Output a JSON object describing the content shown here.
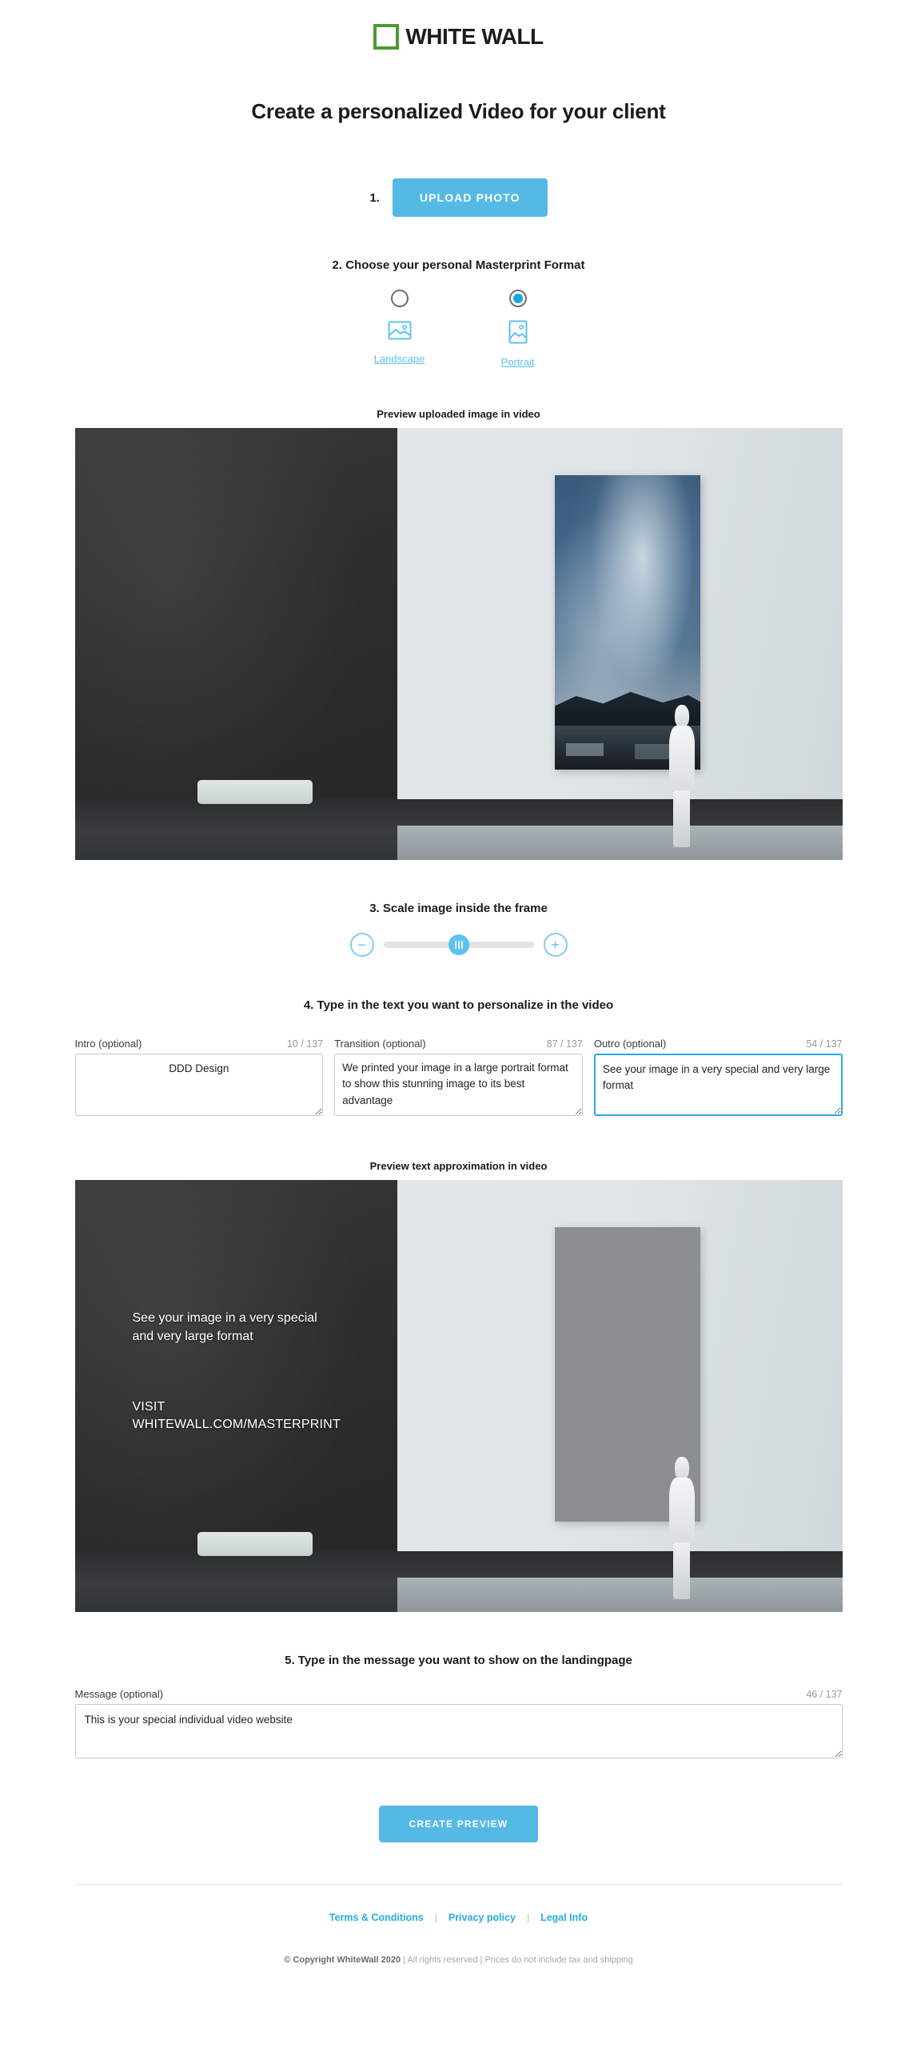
{
  "brand": {
    "logo_text": "WHITE WALL",
    "logo_mark_color": "#4b9b33"
  },
  "page_title": "Create a personalized Video for your client",
  "step1": {
    "number": "1.",
    "upload_button": "UPLOAD PHOTO"
  },
  "step2": {
    "heading": "2. Choose your personal Masterprint Format",
    "options": [
      {
        "label": "Landscape",
        "selected": false
      },
      {
        "label": "Portrait",
        "selected": true
      }
    ]
  },
  "preview1": {
    "caption": "Preview uploaded image in video"
  },
  "step3": {
    "heading": "3. Scale image inside the frame",
    "minus": "−",
    "plus": "+",
    "value_percent": 50
  },
  "step4": {
    "heading": "4. Type in the text you want to personalize in the video",
    "fields": [
      {
        "label": "Intro (optional)",
        "counter": "10 / 137",
        "value": "DDD Design",
        "focused": false,
        "centered": true
      },
      {
        "label": "Transition (optional)",
        "counter": "87 / 137",
        "value": "We printed your image in a large portrait format to show this stunning image to its best advantage",
        "focused": false,
        "centered": false
      },
      {
        "label": "Outro (optional)",
        "counter": "54 / 137",
        "value": "See your image in a very special and very large format",
        "focused": true,
        "centered": false
      }
    ]
  },
  "preview2": {
    "caption": "Preview text approximation in video",
    "overlay_text": "See your image in a very special\nand very large format",
    "overlay_visit": "VISIT\nWHITEWALL.COM/MASTERPRINT"
  },
  "step5": {
    "heading": "5. Type in the message you want to show on the landingpage",
    "label": "Message (optional)",
    "counter": "46 / 137",
    "value": "This is your special individual video website"
  },
  "create_button": "CREATE PREVIEW",
  "footer": {
    "links": [
      "Terms & Conditions",
      "Privacy policy",
      "Legal Info"
    ],
    "separator": "|",
    "copyright_bold": "© Copyright WhiteWall 2020",
    "copyright_rest": " | All rights reserved | Prices do not include tax and shipping"
  },
  "colors": {
    "accent": "#55b9e6",
    "link": "#29abe2",
    "brand_green": "#4b9b33"
  }
}
